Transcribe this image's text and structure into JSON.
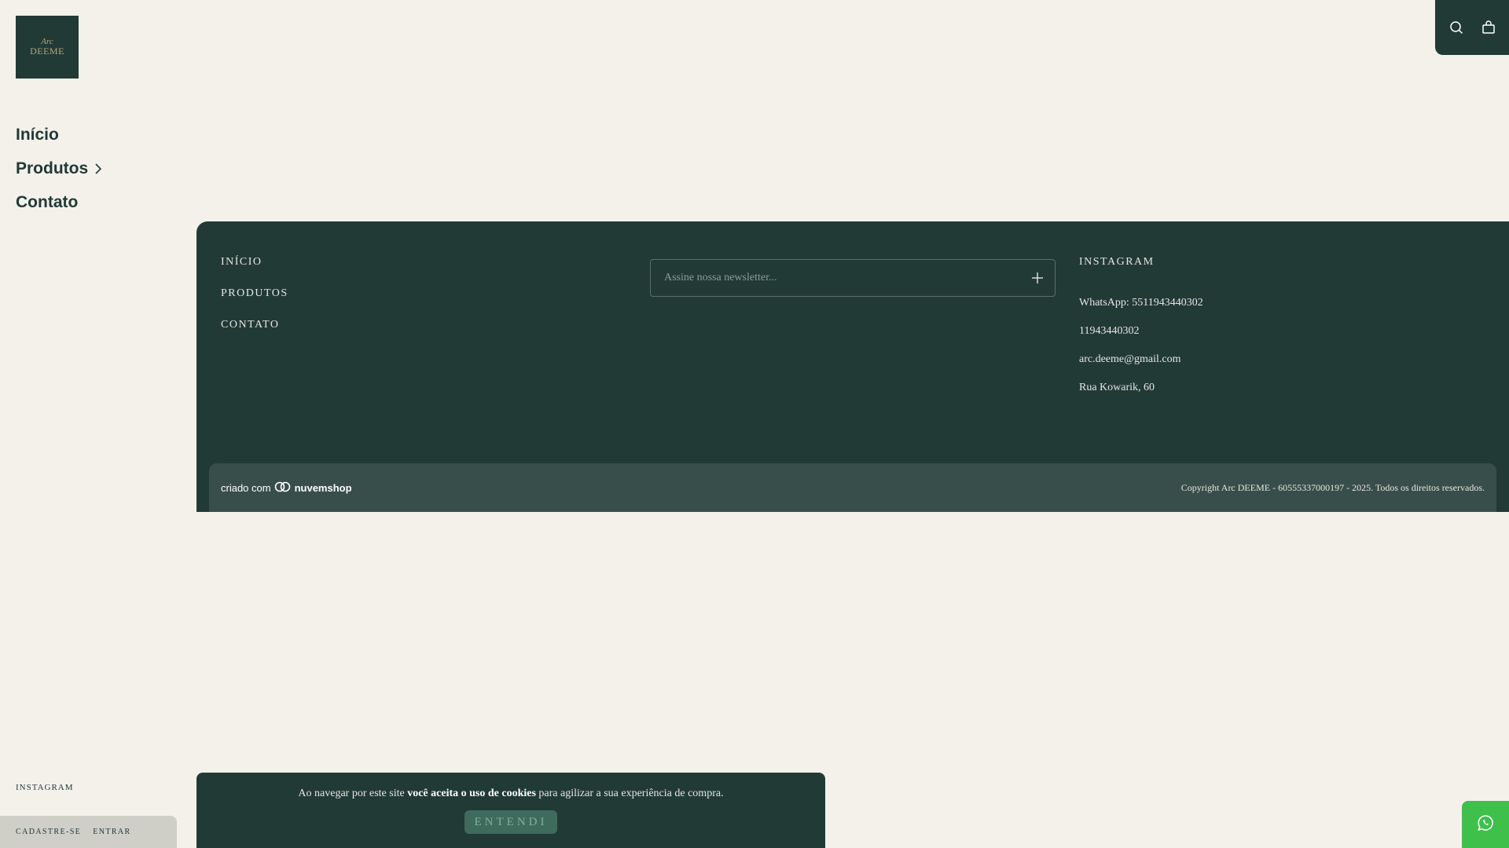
{
  "sidebar": {
    "logo": {
      "script": "Arc",
      "word": "DEEME"
    },
    "nav": [
      {
        "label": "Início"
      },
      {
        "label": "Produtos"
      },
      {
        "label": "Contato"
      }
    ],
    "instagram": "INSTAGRAM",
    "account": {
      "register": "CADASTRE-SE",
      "login": "ENTRAR"
    }
  },
  "header": {
    "icons": [
      "search-icon",
      "shopping-bag-icon"
    ]
  },
  "footer": {
    "links": [
      "INÍCIO",
      "PRODUTOS",
      "CONTATO"
    ],
    "newsletter": {
      "placeholder": "Assine nossa newsletter..."
    },
    "contact": {
      "instagram": "INSTAGRAM",
      "whatsapp": "WhatsApp: 5511943440302",
      "phone": "11943440302",
      "email": "arc.deeme@gmail.com",
      "address": "Rua Kowarik, 60"
    },
    "platform": {
      "prefix": "criado com",
      "brand": "nuvemshop"
    },
    "copyright": "Copyright Arc DEEME - 60555337000197 - 2025. Todos os direitos reservados."
  },
  "cookie": {
    "text_before": "Ao navegar por este site ",
    "text_bold": "você aceita o uso de cookies",
    "text_after": " para agilizar a sua experiência de compra.",
    "button": "ENTENDI"
  },
  "colors": {
    "background": "#f4f1ea",
    "primary": "#213a36",
    "whatsapp": "#3ec04a"
  }
}
